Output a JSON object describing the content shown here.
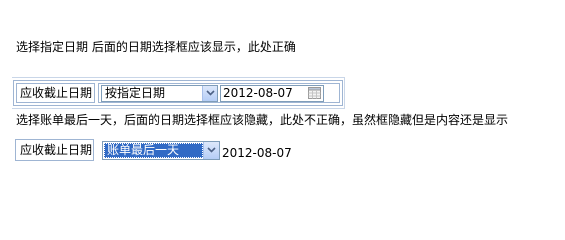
{
  "notes": {
    "first": "选择指定日期  后面的日期选择框应该显示，此处正确",
    "second": "选择账单最后一天，后面的日期选择框应该隐藏，此处不正确，虽然框隐藏但是内容还是显示"
  },
  "row1": {
    "label": "应收截止日期",
    "select_value": "按指定日期",
    "date_value": "2012-08-07"
  },
  "row2": {
    "label": "应收截止日期",
    "select_value": "账单最后一天",
    "date_text": "2012-08-07"
  },
  "icons": {
    "dropdown": "chevron-down-icon",
    "calendar": "calendar-icon"
  },
  "colors": {
    "select_highlight": "#316ac5",
    "border": "#9fb5d3"
  }
}
